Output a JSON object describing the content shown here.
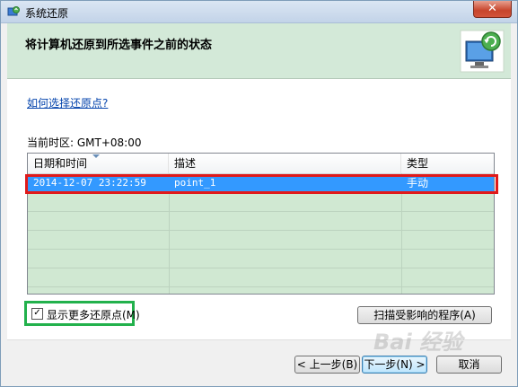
{
  "window": {
    "title": "系统还原",
    "close_label": "✕"
  },
  "header": {
    "title": "将计算机还原到所选事件之前的状态",
    "icon": "system-restore-monitor-icon"
  },
  "content": {
    "help_link": "如何选择还原点?",
    "timezone": "当前时区: GMT+08:00"
  },
  "restore_list": {
    "columns": [
      "日期和时间",
      "描述",
      "类型"
    ],
    "rows": [
      {
        "datetime": "2014-12-07 23:22:59",
        "description": "point_1",
        "type": "手动"
      }
    ],
    "selected_color": "#3399ff",
    "background_color": "#d0e8d2"
  },
  "show_more": {
    "label": "显示更多还原点(M)",
    "checked": true,
    "check_mark": "✓"
  },
  "buttons": {
    "scan": "扫描受影响的程序(A)",
    "back": "< 上一步(B)",
    "next": "下一步(N) >",
    "cancel": "取消"
  },
  "annotations": {
    "red_box_color": "#e01a1a",
    "green_box_color": "#22b14c"
  },
  "watermark": "Bai 经验"
}
